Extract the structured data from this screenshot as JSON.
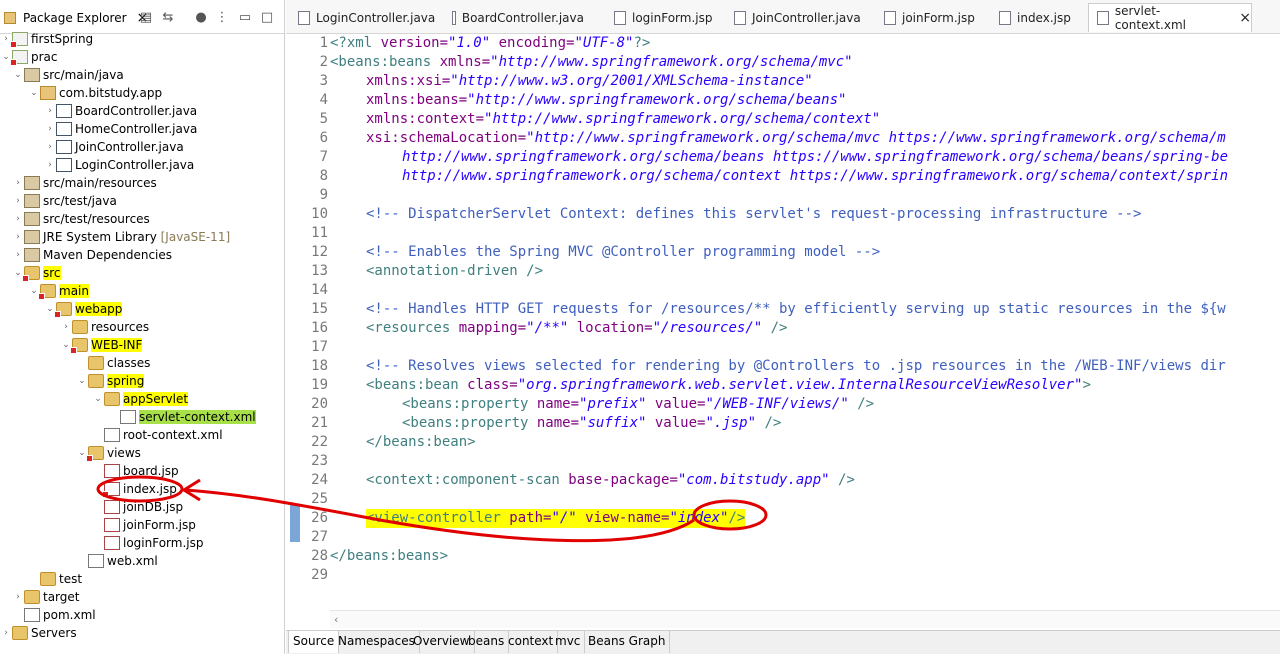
{
  "explorer": {
    "title": "Package Explorer",
    "close_glyph": "×",
    "toolbar_icons": [
      "collapse-all-icon",
      "link-editor-icon",
      "focus-icon",
      "view-menu-icon",
      "minimize-icon",
      "maximize-icon"
    ],
    "items": [
      {
        "label": "firstSpring",
        "extra": ""
      },
      {
        "label": "prac",
        "extra": ""
      },
      {
        "label": "src/main/java",
        "extra": ""
      },
      {
        "label": "com.bitstudy.app",
        "extra": ""
      },
      {
        "label": "BoardController.java",
        "extra": ""
      },
      {
        "label": "HomeController.java",
        "extra": ""
      },
      {
        "label": "JoinController.java",
        "extra": ""
      },
      {
        "label": "LoginController.java",
        "extra": ""
      },
      {
        "label": "src/main/resources",
        "extra": ""
      },
      {
        "label": "src/test/java",
        "extra": ""
      },
      {
        "label": "src/test/resources",
        "extra": ""
      },
      {
        "label": "JRE System Library",
        "extra": "[JavaSE-11]"
      },
      {
        "label": "Maven Dependencies",
        "extra": ""
      },
      {
        "label": "src",
        "extra": ""
      },
      {
        "label": "main",
        "extra": ""
      },
      {
        "label": "webapp",
        "extra": ""
      },
      {
        "label": "resources",
        "extra": ""
      },
      {
        "label": "WEB-INF",
        "extra": ""
      },
      {
        "label": "classes",
        "extra": ""
      },
      {
        "label": "spring",
        "extra": ""
      },
      {
        "label": "appServlet",
        "extra": ""
      },
      {
        "label": "servlet-context.xml",
        "extra": ""
      },
      {
        "label": "root-context.xml",
        "extra": ""
      },
      {
        "label": "views",
        "extra": ""
      },
      {
        "label": "board.jsp",
        "extra": ""
      },
      {
        "label": "index.jsp",
        "extra": ""
      },
      {
        "label": "joinDB.jsp",
        "extra": ""
      },
      {
        "label": "joinForm.jsp",
        "extra": ""
      },
      {
        "label": "loginForm.jsp",
        "extra": ""
      },
      {
        "label": "web.xml",
        "extra": ""
      },
      {
        "label": "test",
        "extra": ""
      },
      {
        "label": "target",
        "extra": ""
      },
      {
        "label": "pom.xml",
        "extra": ""
      },
      {
        "label": "Servers",
        "extra": ""
      }
    ]
  },
  "editor_tabs": [
    "LoginController.java",
    "BoardController.java",
    "loginForm.jsp",
    "JoinController.java",
    "joinForm.jsp",
    "index.jsp",
    "servlet-context.xml"
  ],
  "active_tab_close": "×",
  "line_numbers": [
    "1",
    "2",
    "3",
    "4",
    "5",
    "6",
    "7",
    "8",
    "9",
    "10",
    "11",
    "12",
    "13",
    "14",
    "15",
    "16",
    "17",
    "18",
    "19",
    "20",
    "21",
    "22",
    "23",
    "24",
    "25",
    "26",
    "27",
    "28",
    "29"
  ],
  "code": {
    "l1a": "<?xml ",
    "l1b": "version=",
    "l1c": "\"1.0\"",
    "l1d": " encoding=",
    "l1e": "\"UTF-8\"",
    "l1f": "?>",
    "l2a": "<beans:beans ",
    "l2b": "xmlns=",
    "l2c": "\"http://www.springframework.org/schema/mvc\"",
    "l3a": "xmlns:xsi=",
    "l3b": "\"http://www.w3.org/2001/XMLSchema-instance\"",
    "l4a": "xmlns:beans=",
    "l4b": "\"http://www.springframework.org/schema/beans\"",
    "l5a": "xmlns:context=",
    "l5b": "\"http://www.springframework.org/schema/context\"",
    "l6a": "xsi:schemaLocation=",
    "l6b": "\"http://www.springframework.org/schema/mvc https://www.springframework.org/schema/m",
    "l7": "http://www.springframework.org/schema/beans https://www.springframework.org/schema/beans/spring-be",
    "l8": "http://www.springframework.org/schema/context https://www.springframework.org/schema/context/sprin",
    "l10": "<!-- DispatcherServlet Context: defines this servlet's request-processing infrastructure -->",
    "l12": "<!-- Enables the Spring MVC @Controller programming model -->",
    "l13": "<annotation-driven />",
    "l15": "<!-- Handles HTTP GET requests for /resources/** by efficiently serving up static resources in the ${w",
    "l16a": "<resources ",
    "l16b": "mapping=",
    "l16c": "\"/**\"",
    "l16d": " location=",
    "l16e": "\"/resources/\"",
    "l16f": " />",
    "l18": "<!-- Resolves views selected for rendering by @Controllers to .jsp resources in the /WEB-INF/views dir",
    "l19a": "<beans:bean ",
    "l19b": "class=",
    "l19c": "\"org.springframework.web.servlet.view.InternalResourceViewResolver\"",
    "l19d": ">",
    "l20a": "<beans:property ",
    "l20b": "name=",
    "l20c": "\"prefix\"",
    "l20d": " value=",
    "l20e": "\"/WEB-INF/views/\"",
    "l20f": " />",
    "l21a": "<beans:property ",
    "l21b": "name=",
    "l21c": "\"suffix\"",
    "l21d": " value=",
    "l21e": "\".jsp\"",
    "l21f": " />",
    "l22": "</beans:bean>",
    "l24a": "<context:component-scan ",
    "l24b": "base-package=",
    "l24c": "\"com.bitstudy.app\"",
    "l24d": " />",
    "l26a": "<view-controller ",
    "l26b": "path=",
    "l26c": "\"/\"",
    "l26d": " view-name=",
    "l26e": "\"index\"",
    "l26f": "/>",
    "l28": "</beans:beans>"
  },
  "bottom_tabs": [
    "Source",
    "Namespaces",
    "Overview",
    "beans",
    "context",
    "mvc",
    "Beans Graph"
  ],
  "colors": {
    "highlight": "#ffff00",
    "highlight_green": "#a8e04a",
    "annotation": "#e00000"
  }
}
